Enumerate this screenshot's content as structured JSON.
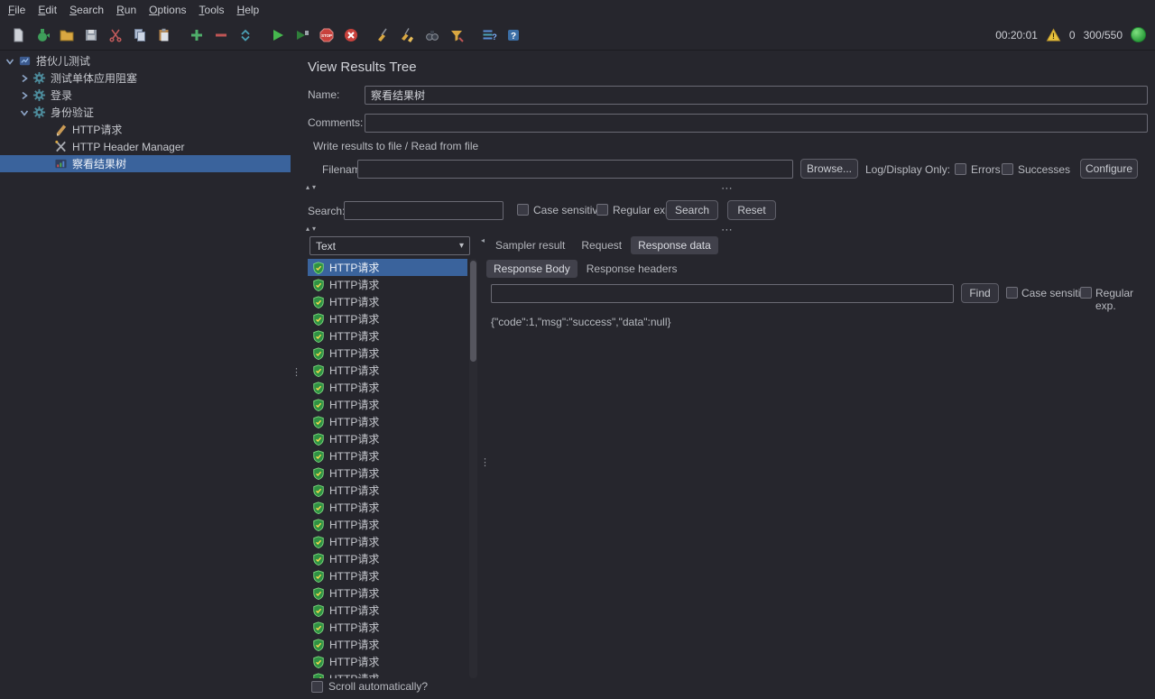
{
  "menubar": {
    "items": [
      "File",
      "Edit",
      "Search",
      "Run",
      "Options",
      "Tools",
      "Help"
    ]
  },
  "toolbar": {
    "elapsed_time": "00:20:01",
    "error_count": "0",
    "thread_counts": "300/550",
    "icons": [
      "new",
      "templates",
      "open",
      "save",
      "cut",
      "copy",
      "paste",
      "expand-all",
      "collapse-all",
      "toggle",
      "start",
      "start-no-timers",
      "stop",
      "shutdown",
      "clear",
      "clear-all",
      "search",
      "search-reset",
      "function-helper",
      "help"
    ],
    "status_color": "#3fbf4f",
    "warning_color": "#e8c33c"
  },
  "tree": {
    "nodes": [
      {
        "label": "搭伙儿测试"
      },
      {
        "label": "测试单体应用阻塞"
      },
      {
        "label": "登录"
      },
      {
        "label": "身份验证"
      },
      {
        "label": "HTTP请求"
      },
      {
        "label": "HTTP Header Manager"
      },
      {
        "label": "察看结果树",
        "selected": true
      }
    ]
  },
  "main": {
    "title": "View Results Tree",
    "name_label": "Name:",
    "name_value": "察看结果树",
    "comments_label": "Comments:",
    "comments_value": "",
    "file_panel": {
      "title": "Write results to file / Read from file",
      "filename_label": "Filename",
      "filename_value": "",
      "browse_button": "Browse...",
      "log_display_label": "Log/Display Only:",
      "errors_label": "Errors",
      "successes_label": "Successes",
      "configure_button": "Configure"
    },
    "search_panel": {
      "label": "Search:",
      "value": "",
      "case_sensitive_label": "Case sensitive",
      "regex_label": "Regular exp.",
      "search_button": "Search",
      "reset_button": "Reset"
    },
    "results": {
      "view_selector": "Text",
      "scroll_label": "Scroll automatically?",
      "items": [
        {
          "label": "HTTP请求",
          "selected": true
        },
        {
          "label": "HTTP请求"
        },
        {
          "label": "HTTP请求"
        },
        {
          "label": "HTTP请求"
        },
        {
          "label": "HTTP请求"
        },
        {
          "label": "HTTP请求"
        },
        {
          "label": "HTTP请求"
        },
        {
          "label": "HTTP请求"
        },
        {
          "label": "HTTP请求"
        },
        {
          "label": "HTTP请求"
        },
        {
          "label": "HTTP请求"
        },
        {
          "label": "HTTP请求"
        },
        {
          "label": "HTTP请求"
        },
        {
          "label": "HTTP请求"
        },
        {
          "label": "HTTP请求"
        },
        {
          "label": "HTTP请求"
        },
        {
          "label": "HTTP请求"
        },
        {
          "label": "HTTP请求"
        },
        {
          "label": "HTTP请求"
        },
        {
          "label": "HTTP请求"
        },
        {
          "label": "HTTP请求"
        },
        {
          "label": "HTTP请求"
        },
        {
          "label": "HTTP请求"
        },
        {
          "label": "HTTP请求"
        },
        {
          "label": "HTTP请求"
        }
      ]
    },
    "detail": {
      "tabs": [
        {
          "label": "Sampler result"
        },
        {
          "label": "Request"
        },
        {
          "label": "Response data",
          "selected": true
        }
      ],
      "subtabs": [
        {
          "label": "Response Body",
          "selected": true
        },
        {
          "label": "Response headers"
        }
      ],
      "find": {
        "value": "",
        "find_button": "Find",
        "case_sensitive_label": "Case sensitive",
        "regex_label": "Regular exp."
      },
      "response_body": "{\"code\":1,\"msg\":\"success\",\"data\":null}"
    }
  }
}
